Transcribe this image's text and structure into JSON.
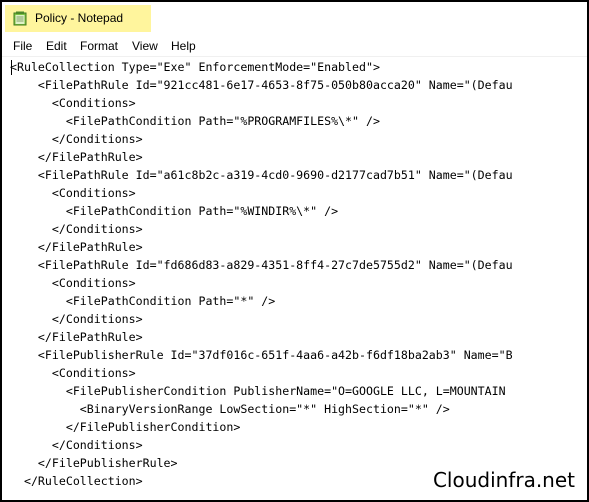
{
  "window": {
    "title": "Policy - Notepad",
    "icon": "notepad-icon"
  },
  "menu": {
    "items": [
      "File",
      "Edit",
      "Format",
      "View",
      "Help"
    ]
  },
  "editor": {
    "lines": [
      "<RuleCollection Type=\"Exe\" EnforcementMode=\"Enabled\">",
      "    <FilePathRule Id=\"921cc481-6e17-4653-8f75-050b80acca20\" Name=\"(Defau",
      "      <Conditions>",
      "        <FilePathCondition Path=\"%PROGRAMFILES%\\*\" />",
      "      </Conditions>",
      "    </FilePathRule>",
      "    <FilePathRule Id=\"a61c8b2c-a319-4cd0-9690-d2177cad7b51\" Name=\"(Defau",
      "      <Conditions>",
      "        <FilePathCondition Path=\"%WINDIR%\\*\" />",
      "      </Conditions>",
      "    </FilePathRule>",
      "    <FilePathRule Id=\"fd686d83-a829-4351-8ff4-27c7de5755d2\" Name=\"(Defau",
      "      <Conditions>",
      "        <FilePathCondition Path=\"*\" />",
      "      </Conditions>",
      "    </FilePathRule>",
      "    <FilePublisherRule Id=\"37df016c-651f-4aa6-a42b-f6df18ba2ab3\" Name=\"B",
      "      <Conditions>",
      "        <FilePublisherCondition PublisherName=\"O=GOOGLE LLC, L=MOUNTAIN",
      "          <BinaryVersionRange LowSection=\"*\" HighSection=\"*\" />",
      "        </FilePublisherCondition>",
      "      </Conditions>",
      "    </FilePublisherRule>",
      "  </RuleCollection>"
    ]
  },
  "watermark": {
    "text": "Cloudinfra.net"
  }
}
